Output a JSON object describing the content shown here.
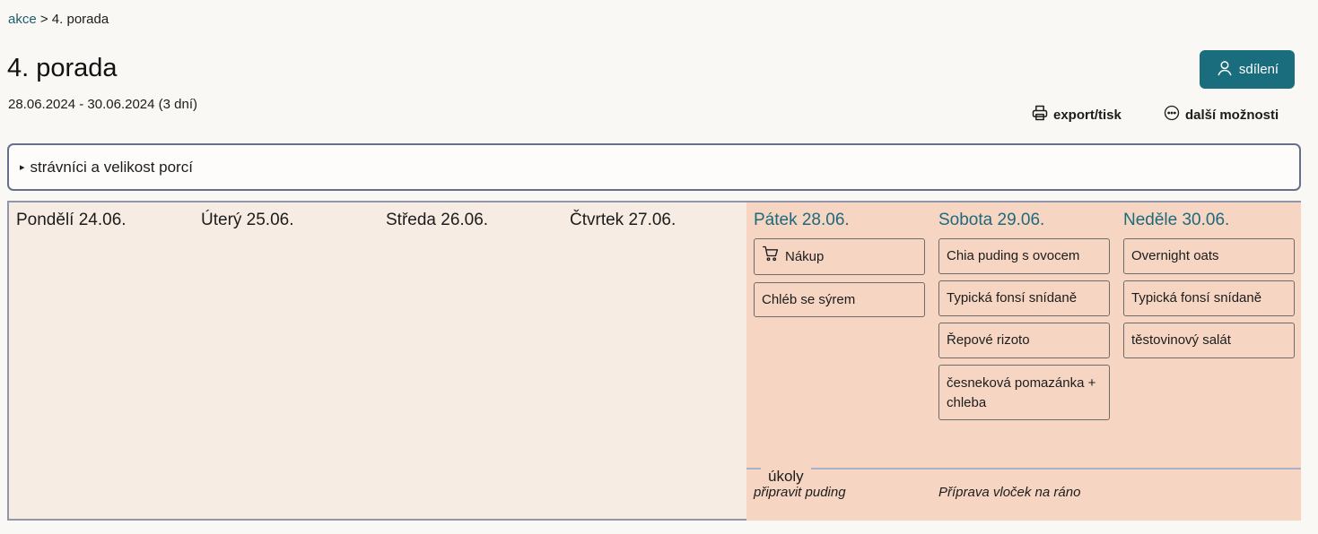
{
  "breadcrumb": {
    "link": "akce",
    "separator": ">",
    "current": "4. porada"
  },
  "page": {
    "title": "4. porada",
    "date_range": "28.06.2024 - 30.06.2024 (3 dní)"
  },
  "actions": {
    "share": "sdílení",
    "export": "export/tisk",
    "more": "další možnosti"
  },
  "details": {
    "triangle": "▸",
    "label": "strávníci a velikost porcí"
  },
  "days": [
    {
      "title": "Pondělí 24.06.",
      "meals": []
    },
    {
      "title": "Úterý 25.06.",
      "meals": []
    },
    {
      "title": "Středa 26.06.",
      "meals": []
    },
    {
      "title": "Čtvrtek 27.06.",
      "meals": []
    },
    {
      "title": "Pátek 28.06.",
      "meals": [
        "Nákup",
        "Chléb se sýrem"
      ]
    },
    {
      "title": "Sobota 29.06.",
      "meals": [
        "Chia puding s ovocem",
        "Typická fonsí snídaně",
        "Řepové rizoto",
        "česneková pomazánka + chleba"
      ]
    },
    {
      "title": "Neděle 30.06.",
      "meals": [
        "Overnight oats",
        "Typická fonsí snídaně",
        "těstovinový salát"
      ]
    }
  ],
  "tasks": {
    "label": "úkoly",
    "items": [
      "připravit puding",
      "Příprava vloček na ráno"
    ]
  },
  "colors": {
    "accent": "#1a6d7c",
    "active_bg": "#f6d6c3",
    "inactive_bg": "#f7ece4"
  },
  "icons": {
    "share": "user-icon",
    "export": "printer-icon",
    "more": "more-circle-icon",
    "shopping": "cart-icon"
  }
}
